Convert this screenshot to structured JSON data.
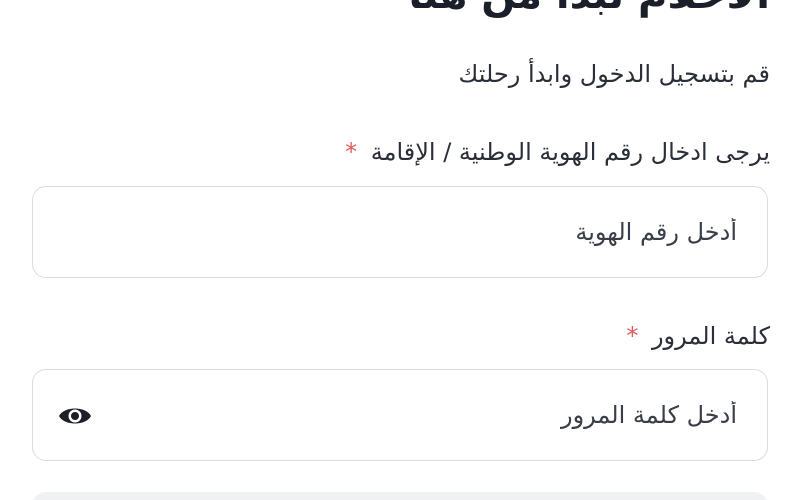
{
  "header": {
    "title": "الأحلام تبدأ من هنا",
    "subtitle": "قم بتسجيل الدخول وابدأ رحلتك"
  },
  "form": {
    "id_field": {
      "label": "يرجى ادخال رقم الهوية الوطنية / الإقامة",
      "required_mark": "*",
      "placeholder": "أدخل رقم الهوية",
      "value": ""
    },
    "password_field": {
      "label": "كلمة المرور",
      "required_mark": "*",
      "placeholder": "أدخل كلمة المرور",
      "value": "",
      "toggle_icon": "eye-icon"
    }
  },
  "colors": {
    "required": "#e25b5b",
    "border": "#d9dde3",
    "text": "#2a2e38"
  }
}
